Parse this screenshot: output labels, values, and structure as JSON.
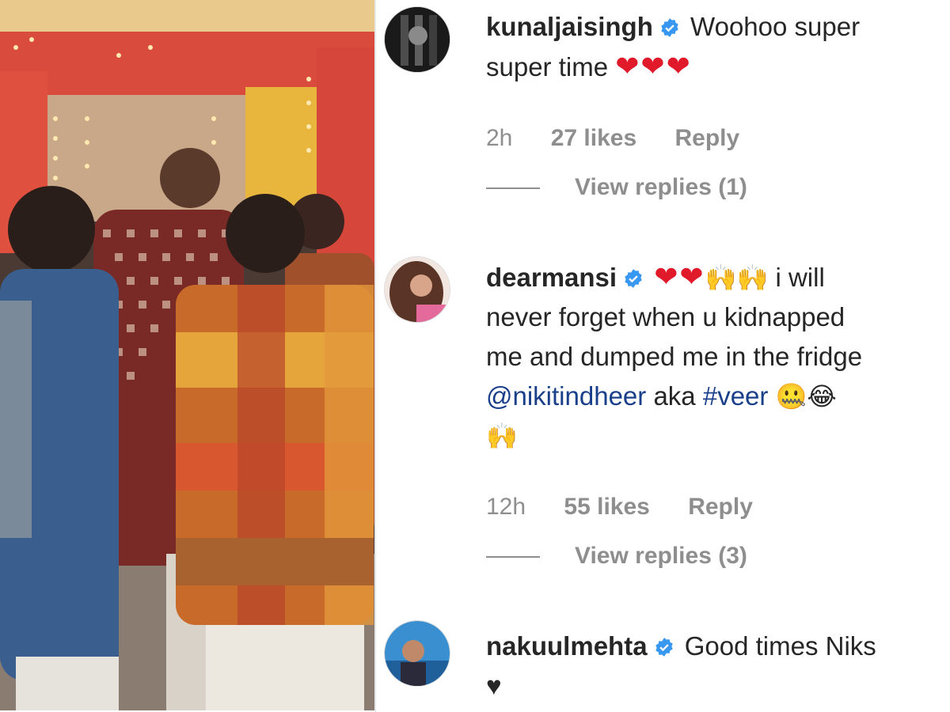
{
  "media": {
    "description_icon": "video-still"
  },
  "comments": [
    {
      "username": "kunaljaisingh",
      "verified_icon": "verified-badge-icon",
      "text_line1": "Woohoo super",
      "text_line2": "super time",
      "hearts": "❤❤❤",
      "time": "2h",
      "likes": "27 likes",
      "reply": "Reply",
      "view_replies": "View replies (1)"
    },
    {
      "username": "dearmansi",
      "verified_icon": "verified-badge-icon",
      "hearts": "❤❤",
      "hands": "🙌🙌",
      "text_line1": "i will",
      "text_line2": "never forget when u kidnapped",
      "text_line3": "me and dumped me in the fridge",
      "mention": "@nikitindheer",
      "aka": "aka",
      "hashtag": "#veer",
      "end_emojis": "🤐😂",
      "last_line_emoji": "🙌",
      "time": "12h",
      "likes": "55 likes",
      "reply": "Reply",
      "view_replies": "View replies (3)"
    },
    {
      "username": "nakuulmehta",
      "verified_icon": "verified-badge-icon",
      "text_line1": "Good times Niks",
      "text_line2": "♥"
    }
  ],
  "colors": {
    "text": "#262626",
    "muted": "#8e8e8e",
    "verified": "#3897f0",
    "heart": "#e0192b",
    "link": "#1a3f8a"
  }
}
